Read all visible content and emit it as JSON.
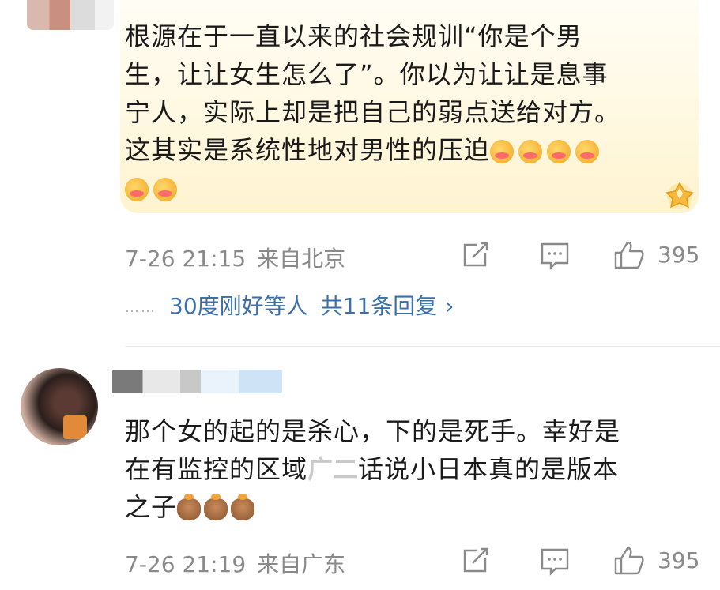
{
  "comments": [
    {
      "text_lines": [
        "根源在于一直以来的社会规训“你是个男",
        "生，让让女生怎么了”。你以为让让是息事",
        "宁人，实际上却是把自己的弱点送给对方。",
        "这其实是系统性地对男性的压迫"
      ],
      "emoji_name": "flushed-love-emoji",
      "time": "7-26 21:15",
      "location": "来自北京",
      "likes": "395",
      "replies": {
        "dots": "……",
        "replier": "30度刚好等人",
        "count": "共11条回复",
        "chevron": "›"
      }
    },
    {
      "text_lines": [
        "那个女的起的是杀心，下的是死手。幸好是",
        "在有监控的区域",
        "话说小日本真的是版本",
        "之子"
      ],
      "garbled": "广二",
      "emoji_name": "capybara-emoji",
      "time": "7-26 21:19",
      "location": "来自广东",
      "likes": "395"
    }
  ],
  "colors": {
    "link_blue": "#3a6fa8",
    "meta_gray": "#8a8a8a",
    "bubble_yellow": "#fff7dc"
  },
  "icons": [
    "share-icon",
    "comment-icon",
    "like-icon",
    "crown-badge-icon"
  ]
}
